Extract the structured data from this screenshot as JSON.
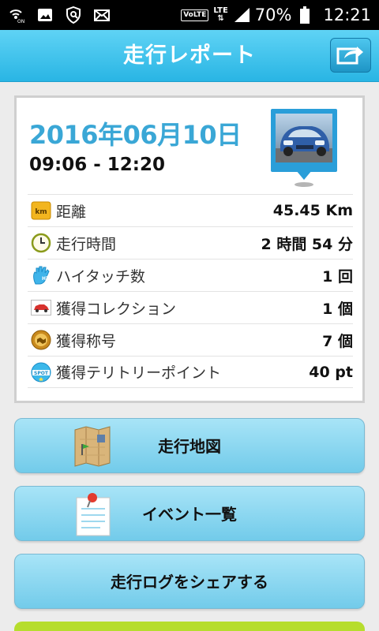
{
  "status_bar": {
    "volte_label": "VoLTE",
    "lte_label": "LTE",
    "battery_percent": "70%",
    "time": "12:21",
    "icons": [
      "wifi-on-icon",
      "gallery-icon",
      "security-icon",
      "mail-icon",
      "signal-icon",
      "battery-icon"
    ]
  },
  "header": {
    "title": "走行レポート",
    "share_icon": "share-icon"
  },
  "report": {
    "date": "2016年06月10日",
    "time_range": "09:06 - 12:20",
    "rows": [
      {
        "icon": "km-icon",
        "label": "距離",
        "value": "45.45 Km"
      },
      {
        "icon": "clock-icon",
        "label": "走行時間",
        "value": "2 時間 54 分"
      },
      {
        "icon": "high-five-icon",
        "label": "ハイタッチ数",
        "value": "1 回"
      },
      {
        "icon": "car-collection-icon",
        "label": "獲得コレクション",
        "value": "1 個"
      },
      {
        "icon": "badge-icon",
        "label": "獲得称号",
        "value": "7 個"
      },
      {
        "icon": "spot-icon",
        "label": "獲得テリトリーポイント",
        "value": "40 pt"
      }
    ],
    "km_icon_text": "km",
    "spot_icon_text": "SPOT"
  },
  "menu": {
    "map_label": "走行地図",
    "events_label": "イベント一覧",
    "share_label": "走行ログをシェアする"
  },
  "colors": {
    "accent": "#29b5e4",
    "date_blue": "#3aa7d6",
    "button_blue": "#86d4ef",
    "green": "#b6dd2d"
  }
}
